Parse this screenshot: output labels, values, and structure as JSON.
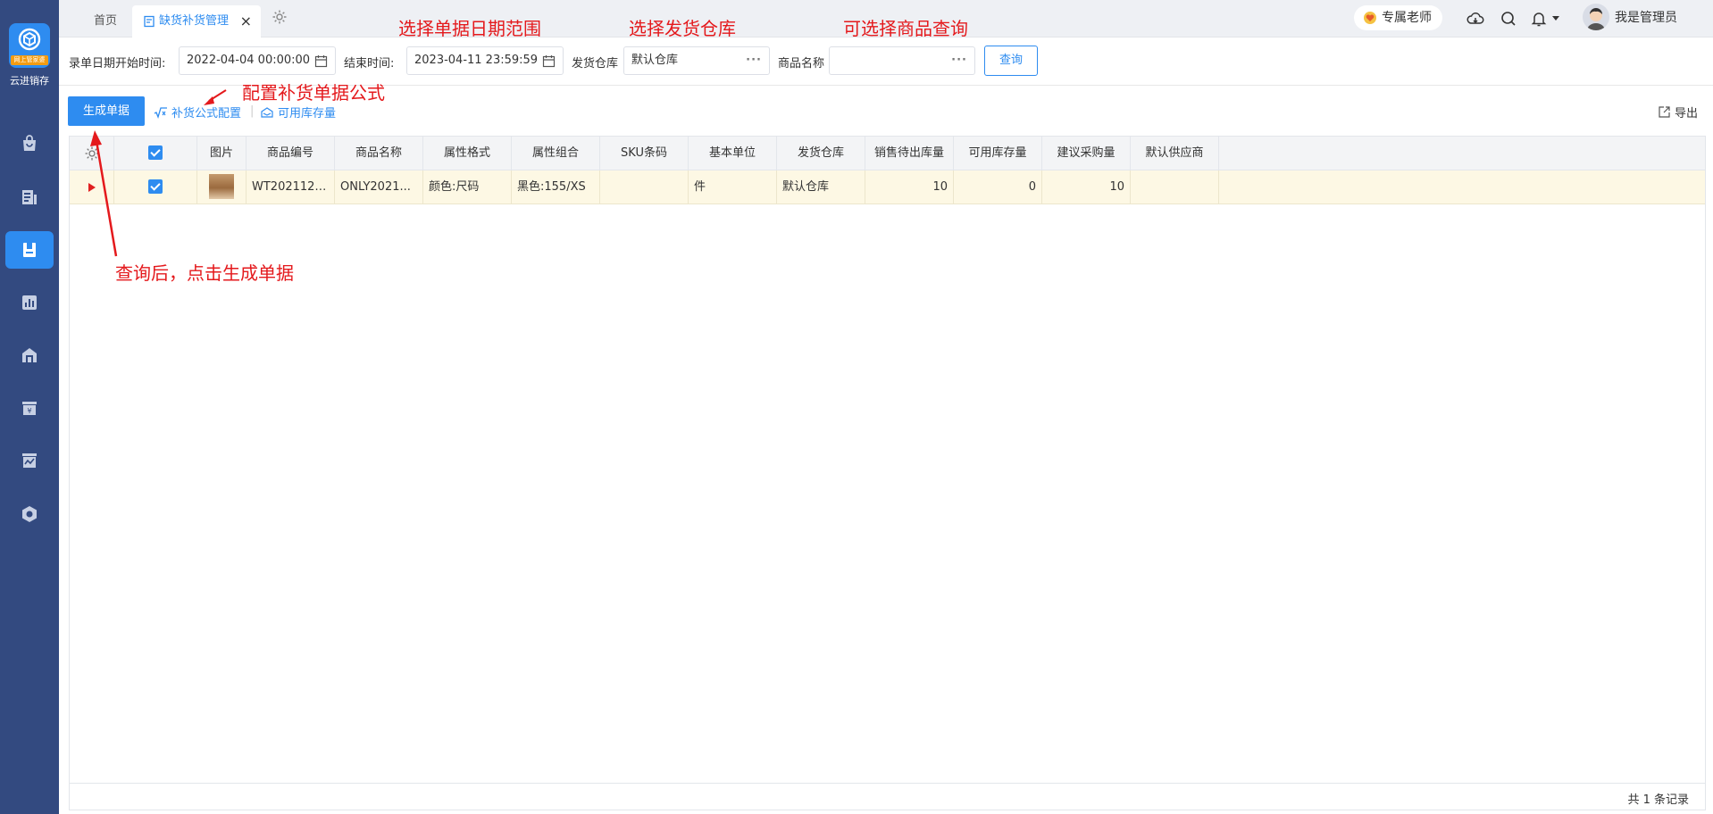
{
  "sidebar": {
    "logo_badge": "网上管家婆",
    "logo_text": "云进销存",
    "items": [
      {
        "icon": "bag-icon"
      },
      {
        "icon": "report-icon"
      },
      {
        "icon": "purchase-icon",
        "active": true
      },
      {
        "icon": "chart-icon"
      },
      {
        "icon": "warehouse-icon"
      },
      {
        "icon": "finance-icon"
      },
      {
        "icon": "store-icon"
      },
      {
        "icon": "settings-hex-icon"
      }
    ]
  },
  "tabs": {
    "home": "首页",
    "active": "缺货补货管理",
    "close": "×"
  },
  "header": {
    "teacher": "专属老师",
    "user_name": "我是管理员"
  },
  "filter": {
    "start_label": "录单日期开始时间:",
    "start_value": "2022-04-04 00:00:00",
    "end_label": "结束时间:",
    "end_value": "2023-04-11 23:59:59",
    "warehouse_label": "发货仓库",
    "warehouse_value": "默认仓库",
    "product_label": "商品名称",
    "product_value": "",
    "query_button": "查询",
    "dots": "···"
  },
  "toolbar": {
    "generate_button": "生成单据",
    "formula_link": "补货公式配置",
    "stock_link": "可用库存量",
    "separator": "|",
    "export": "导出"
  },
  "table": {
    "headers": [
      "图片",
      "商品编号",
      "商品名称",
      "属性格式",
      "属性组合",
      "SKU条码",
      "基本单位",
      "发货仓库",
      "销售待出库量",
      "可用库存量",
      "建议采购量",
      "默认供应商"
    ],
    "rows": [
      {
        "code": "WT2021122...",
        "name": "ONLY2021...",
        "attr_format": "颜色:尺码",
        "attr_combo": "黑色:155/XS",
        "sku": "",
        "unit": "件",
        "warehouse": "默认仓库",
        "pending_out": "10",
        "available": "0",
        "suggested": "10",
        "supplier": ""
      }
    ],
    "footer": "共 1 条记录"
  },
  "annotations": {
    "date_range": "选择单据日期范围",
    "warehouse": "选择发货仓库",
    "product": "可选择商品查询",
    "formula": "配置补货单据公式",
    "generate": "查询后，点击生成单据"
  },
  "colors": {
    "sidebar_bg": "#334a80",
    "accent": "#2e8cf0",
    "annotation": "#e4191c",
    "row_highlight": "#fdf8e4"
  }
}
